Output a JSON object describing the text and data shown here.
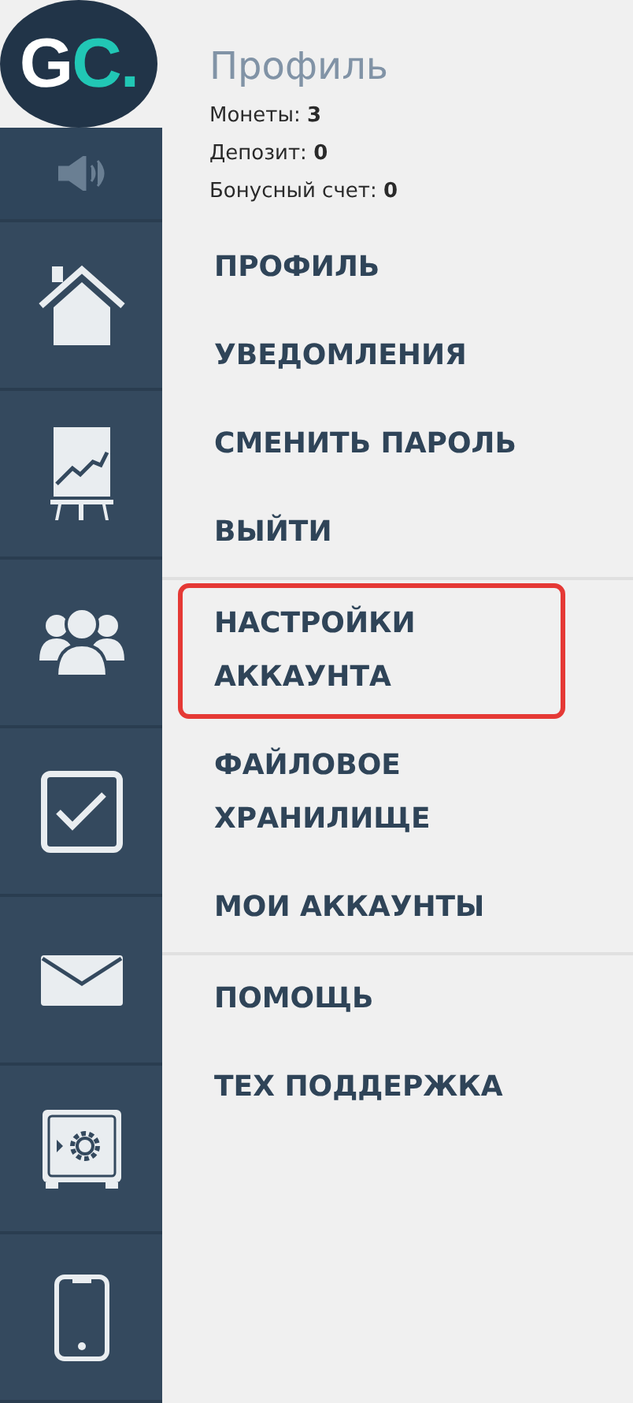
{
  "logo": {
    "parts": [
      {
        "text": "G",
        "color": "#ffffff"
      },
      {
        "text": "C.",
        "color": "#21c7b5"
      }
    ]
  },
  "sidebar": {
    "items": [
      {
        "kind": "sound"
      },
      {
        "kind": "home"
      },
      {
        "kind": "chart"
      },
      {
        "kind": "people"
      },
      {
        "kind": "task"
      },
      {
        "kind": "mail"
      },
      {
        "kind": "safe"
      },
      {
        "kind": "phone"
      }
    ]
  },
  "profile": {
    "title": "Профиль",
    "stats": [
      {
        "label": "Монеты:",
        "value": "3"
      },
      {
        "label": "Депозит:",
        "value": "0"
      },
      {
        "label": "Бонусный счет:",
        "value": "0"
      }
    ]
  },
  "menu": {
    "groups": [
      [
        {
          "label": "ПРОФИЛЬ",
          "highlighted": false
        },
        {
          "label": "УВЕДОМЛЕНИЯ",
          "highlighted": false
        },
        {
          "label": "СМЕНИТЬ ПАРОЛЬ",
          "highlighted": false
        },
        {
          "label": "ВЫЙТИ",
          "highlighted": false
        }
      ],
      [
        {
          "label": "НАСТРОЙКИ АККАУНТА",
          "highlighted": true
        },
        {
          "label": "ФАЙЛОВОЕ ХРАНИЛИЩЕ",
          "highlighted": false
        },
        {
          "label": "МОИ АККАУНТЫ",
          "highlighted": false
        }
      ],
      [
        {
          "label": "ПОМОЩЬ",
          "highlighted": false
        },
        {
          "label": "ТЕХ ПОДДЕРЖКА",
          "highlighted": false
        }
      ]
    ]
  }
}
